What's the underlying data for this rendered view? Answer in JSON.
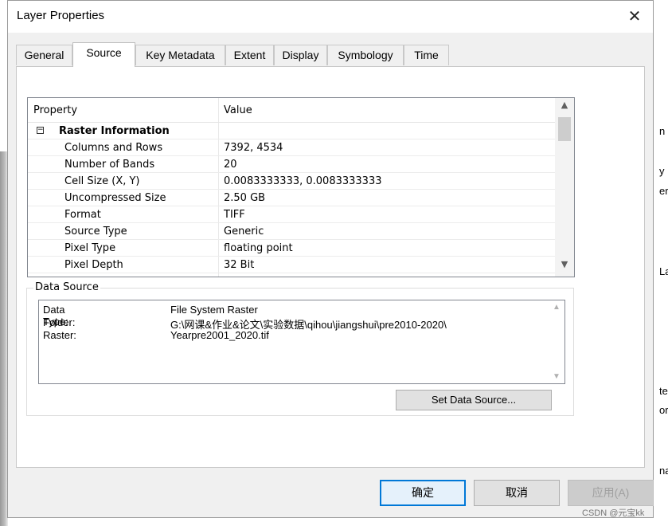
{
  "dialog": {
    "title": "Layer Properties",
    "close_glyph": "✕"
  },
  "tabs": [
    {
      "label": "General"
    },
    {
      "label": "Source",
      "active": true
    },
    {
      "label": "Key Metadata"
    },
    {
      "label": "Extent"
    },
    {
      "label": "Display"
    },
    {
      "label": "Symbology"
    },
    {
      "label": "Time"
    }
  ],
  "properties": {
    "col_property": "Property",
    "col_value": "Value",
    "group_label": "Raster Information",
    "expander_glyph": "−",
    "rows": [
      {
        "property": "Columns and Rows",
        "value": "7392, 4534"
      },
      {
        "property": "Number of Bands",
        "value": "20"
      },
      {
        "property": "Cell Size (X, Y)",
        "value": "0.0083333333, 0.0083333333"
      },
      {
        "property": "Uncompressed Size",
        "value": "2.50 GB"
      },
      {
        "property": "Format",
        "value": "TIFF"
      },
      {
        "property": "Source Type",
        "value": "Generic"
      },
      {
        "property": "Pixel Type",
        "value": "floating point"
      },
      {
        "property": "Pixel Depth",
        "value": "32 Bit"
      }
    ]
  },
  "data_source": {
    "group_label": "Data Source",
    "rows": [
      {
        "key": "Data Type:",
        "value": "File System Raster"
      },
      {
        "key": "Folder:",
        "value": "G:\\网课&作业&论文\\实验数据\\qihou\\jiangshui\\pre2010-2020\\"
      },
      {
        "key": "Raster:",
        "value": "Yearpre2001_2020.tif"
      }
    ],
    "set_button": "Set Data Source..."
  },
  "buttons": {
    "ok": "确定",
    "cancel": "取消",
    "apply": "应用(A)"
  },
  "background_fragments": [
    "n",
    "y",
    "er",
    "La",
    "te",
    "or",
    "na"
  ],
  "watermark": "CSDN @元宝kk",
  "icons": {
    "scroll_up": "▲",
    "scroll_down": "▼"
  }
}
